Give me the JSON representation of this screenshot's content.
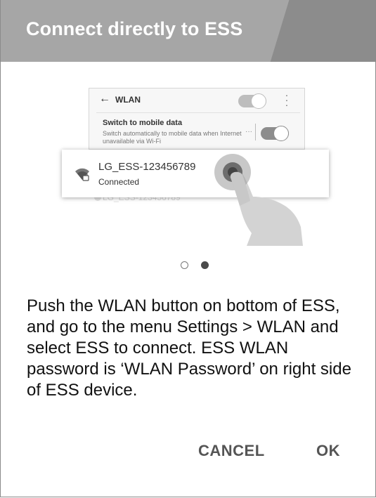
{
  "dialog": {
    "title": "Connect directly to ESS",
    "message": "Push the WLAN button on bottom of ESS, and go to the menu Settings > WLAN and select ESS to connect. ESS WLAN password is ‘WLAN Password’ on right side of ESS device.",
    "cancel_label": "CANCEL",
    "ok_label": "OK"
  },
  "illustration": {
    "back_icon": "←",
    "wlan_title": "WLAN",
    "switch_title": "Switch to mobile data",
    "switch_description": "Switch automatically to mobile data when Internet unavailable via Wi-Fi",
    "network_ssid": "LG_ESS-123456789",
    "network_status": "Connected",
    "ghost_ssid": "LG_ESS-123456789"
  },
  "pager": {
    "total": 2,
    "current": 2
  },
  "colors": {
    "header_dark": "#8c8c8c",
    "header_light": "#a6a6a6",
    "button_text": "#555555"
  }
}
